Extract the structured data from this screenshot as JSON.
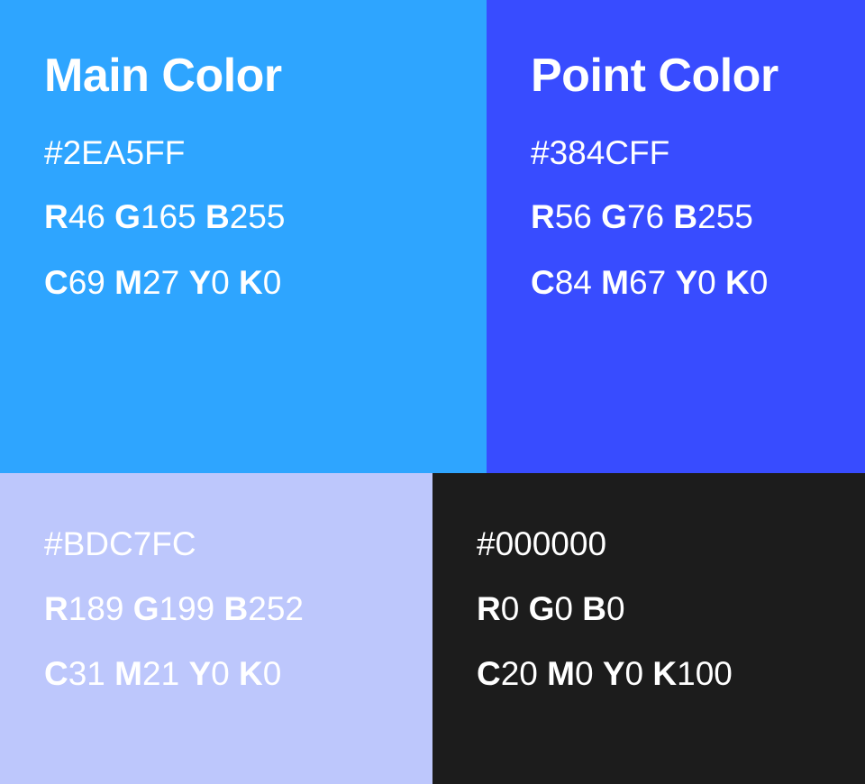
{
  "swatches": [
    {
      "id": "main",
      "title": "Main Color",
      "hex": "#2EA5FF",
      "background": "#2EA5FF",
      "rgb": {
        "r": "46",
        "g": "165",
        "b": "255"
      },
      "cmyk": {
        "c": "69",
        "m": "27",
        "y": "0",
        "k": "0"
      }
    },
    {
      "id": "point",
      "title": "Point Color",
      "hex": "#384CFF",
      "background": "#384CFF",
      "rgb": {
        "r": "56",
        "g": "76",
        "b": "255"
      },
      "cmyk": {
        "c": "84",
        "m": "67",
        "y": "0",
        "k": "0"
      }
    },
    {
      "id": "light",
      "hex": "#BDC7FC",
      "background": "#BDC7FC",
      "rgb": {
        "r": "189",
        "g": "199",
        "b": "252"
      },
      "cmyk": {
        "c": "31",
        "m": "21",
        "y": "0",
        "k": "0"
      }
    },
    {
      "id": "black",
      "hex": "#000000",
      "background": "#1C1C1C",
      "rgb": {
        "r": "0",
        "g": "0",
        "b": "0"
      },
      "cmyk": {
        "c": "20",
        "m": "0",
        "y": "0",
        "k": "100"
      }
    }
  ],
  "labels": {
    "r": "R",
    "g": "G",
    "b": "B",
    "c": "C",
    "m": "M",
    "y": "Y",
    "k": "K"
  }
}
